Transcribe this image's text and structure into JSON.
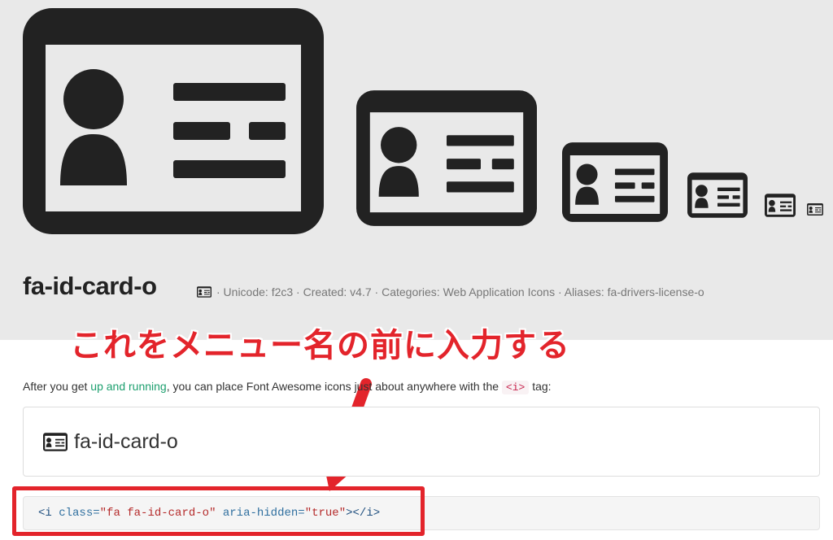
{
  "icon": {
    "name": "fa-id-card-o",
    "meta_text": "· Unicode: f2c3 · Created: v4.7 · Categories: Web Application Icons · Aliases: fa-drivers-license-o",
    "preview_icon": "id-card-icon"
  },
  "annotation": {
    "text": "これをメニュー名の前に入力する",
    "color": "#e3242b"
  },
  "usage": {
    "prefix": "After you get ",
    "link": "up and running",
    "middle": ", you can place Font Awesome icons just about anywhere with the ",
    "tag": "<i>",
    "suffix": " tag:"
  },
  "example": {
    "label": "fa-id-card-o"
  },
  "code": {
    "open": "<i ",
    "class_attr": "class=",
    "class_val": "\"fa fa-id-card-o\"",
    "aria_attr": " aria-hidden=",
    "aria_val": "\"true\"",
    "close": "></i>"
  },
  "colors": {
    "header_bg": "#e9e9e9",
    "icon_color": "#222222",
    "link_color": "#1c9f6e",
    "highlight": "#e3242b"
  }
}
